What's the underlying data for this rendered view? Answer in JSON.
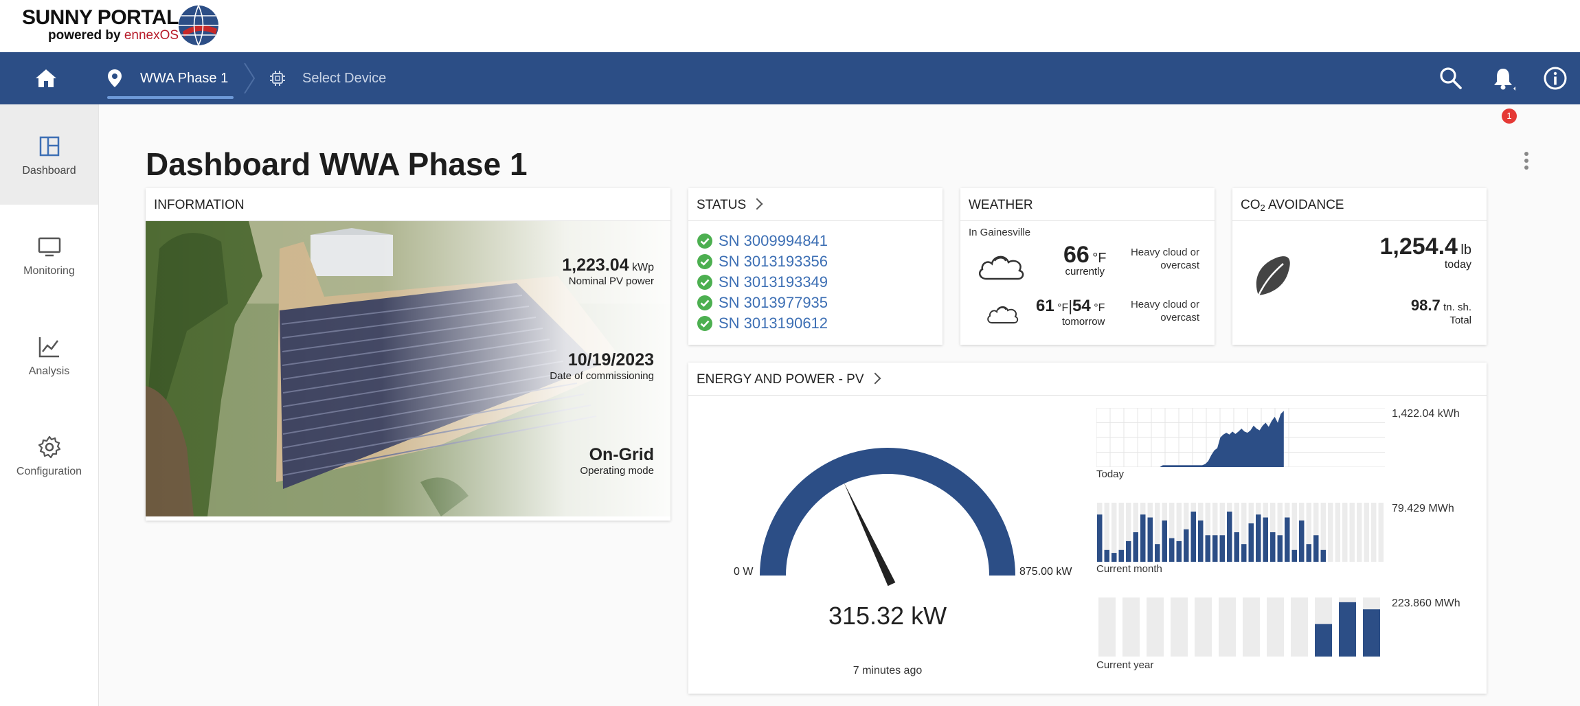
{
  "header": {
    "logo_title": "SUNNY PORTAL",
    "logo_powered": "powered by ",
    "logo_brand": "ennexOS",
    "notification_count": "1"
  },
  "breadcrumb": {
    "plant": "WWA Phase 1",
    "device": "Select Device"
  },
  "sidebar": {
    "items": [
      {
        "label": "Dashboard",
        "icon": "dashboard-icon"
      },
      {
        "label": "Monitoring",
        "icon": "monitor-icon"
      },
      {
        "label": "Analysis",
        "icon": "chart-line-icon"
      },
      {
        "label": "Configuration",
        "icon": "gear-icon"
      }
    ]
  },
  "page": {
    "title": "Dashboard WWA Phase 1"
  },
  "information": {
    "title": "INFORMATION",
    "nominal_power_value": "1,223.04",
    "nominal_power_unit": "kWp",
    "nominal_power_label": "Nominal PV power",
    "commission_date": "10/19/2023",
    "commission_label": "Date of commissioning",
    "mode_value": "On-Grid",
    "mode_label": "Operating mode"
  },
  "status": {
    "title": "STATUS",
    "devices": [
      "SN 3009994841",
      "SN 3013193356",
      "SN 3013193349",
      "SN 3013977935",
      "SN 3013190612"
    ]
  },
  "weather": {
    "title": "WEATHER",
    "location": "In Gainesville",
    "current_temp": "66",
    "current_unit": "°F",
    "current_label": "currently",
    "current_desc_1": "Heavy cloud or",
    "current_desc_2": "overcast",
    "tomorrow_high": "61",
    "tomorrow_high_unit": "°F",
    "tomorrow_sep": "|",
    "tomorrow_low": "54",
    "tomorrow_low_unit": "°F",
    "tomorrow_label": "tomorrow",
    "tomorrow_desc_1": "Heavy cloud or",
    "tomorrow_desc_2": "overcast"
  },
  "co2": {
    "title_prefix": "CO",
    "title_sub": "2",
    "title_suffix": " AVOIDANCE",
    "today_value": "1,254.4",
    "today_unit": "lb",
    "today_label": "today",
    "total_value": "98.7",
    "total_unit": "tn. sh.",
    "total_label": "Total"
  },
  "energy": {
    "title": "ENERGY AND POWER - PV",
    "gauge_min": "0 W",
    "gauge_max": "875.00 kW",
    "current_power": "315.32 kW",
    "current_power_kw": 315.32,
    "max_power_kw": 875,
    "updated": "7 minutes ago",
    "today_label": "Today",
    "today_total": "1,422.04 kWh",
    "month_label": "Current month",
    "month_total": "79.429 MWh",
    "year_label": "Current year",
    "year_total": "223.860 MWh",
    "accent": "#2c4e86",
    "today_profile": [
      0,
      0,
      0,
      0,
      0,
      0,
      0,
      0,
      0,
      0,
      0,
      0,
      0,
      0,
      0,
      0,
      0,
      0,
      0,
      0,
      0,
      0,
      0.03,
      0.03,
      0.03,
      0.03,
      0.03,
      0.03,
      0.03,
      0.03,
      0.03,
      0.03,
      0.03,
      0.03,
      0.03,
      0.03,
      0.05,
      0.1,
      0.2,
      0.28,
      0.32,
      0.5,
      0.55,
      0.58,
      0.55,
      0.6,
      0.56,
      0.6,
      0.65,
      0.6,
      0.58,
      0.62,
      0.7,
      0.65,
      0.62,
      0.7,
      0.75,
      0.68,
      0.78,
      0.85,
      0.75,
      0.9,
      0.95
    ],
    "month_days": [
      0.8,
      0.2,
      0.15,
      0.2,
      0.35,
      0.5,
      0.8,
      0.75,
      0.3,
      0.7,
      0.4,
      0.35,
      0.55,
      0.85,
      0.7,
      0.45,
      0.45,
      0.45,
      0.85,
      0.5,
      0.3,
      0.65,
      0.8,
      0.75,
      0.5,
      0.45,
      0.75,
      0.2,
      0.7,
      0.3,
      0.45,
      0.2
    ],
    "month_elapsed": 32,
    "month_slots": 40,
    "year_months": [
      0,
      0,
      0,
      0,
      0,
      0,
      0,
      0,
      0,
      0.55,
      0.92,
      0.8
    ],
    "year_elapsed_from": 9
  }
}
